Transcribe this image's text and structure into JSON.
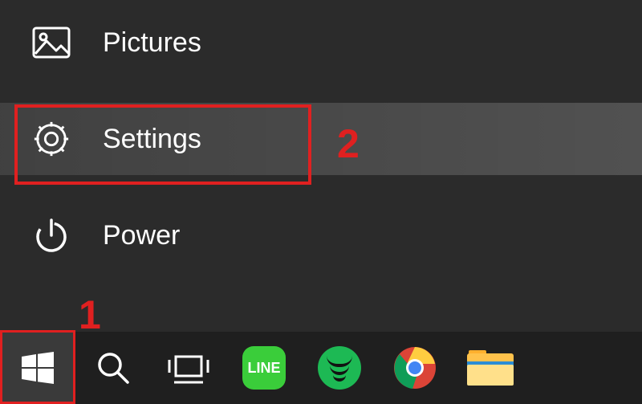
{
  "menu": {
    "pictures": {
      "label": "Pictures"
    },
    "settings": {
      "label": "Settings"
    },
    "power": {
      "label": "Power"
    }
  },
  "annotations": {
    "one": "1",
    "two": "2"
  },
  "taskbar": {
    "start": "Start",
    "search": "Search",
    "taskview": "Task View",
    "line": "LINE",
    "spotify": "Spotify",
    "chrome": "Chrome",
    "explorer": "File Explorer"
  }
}
